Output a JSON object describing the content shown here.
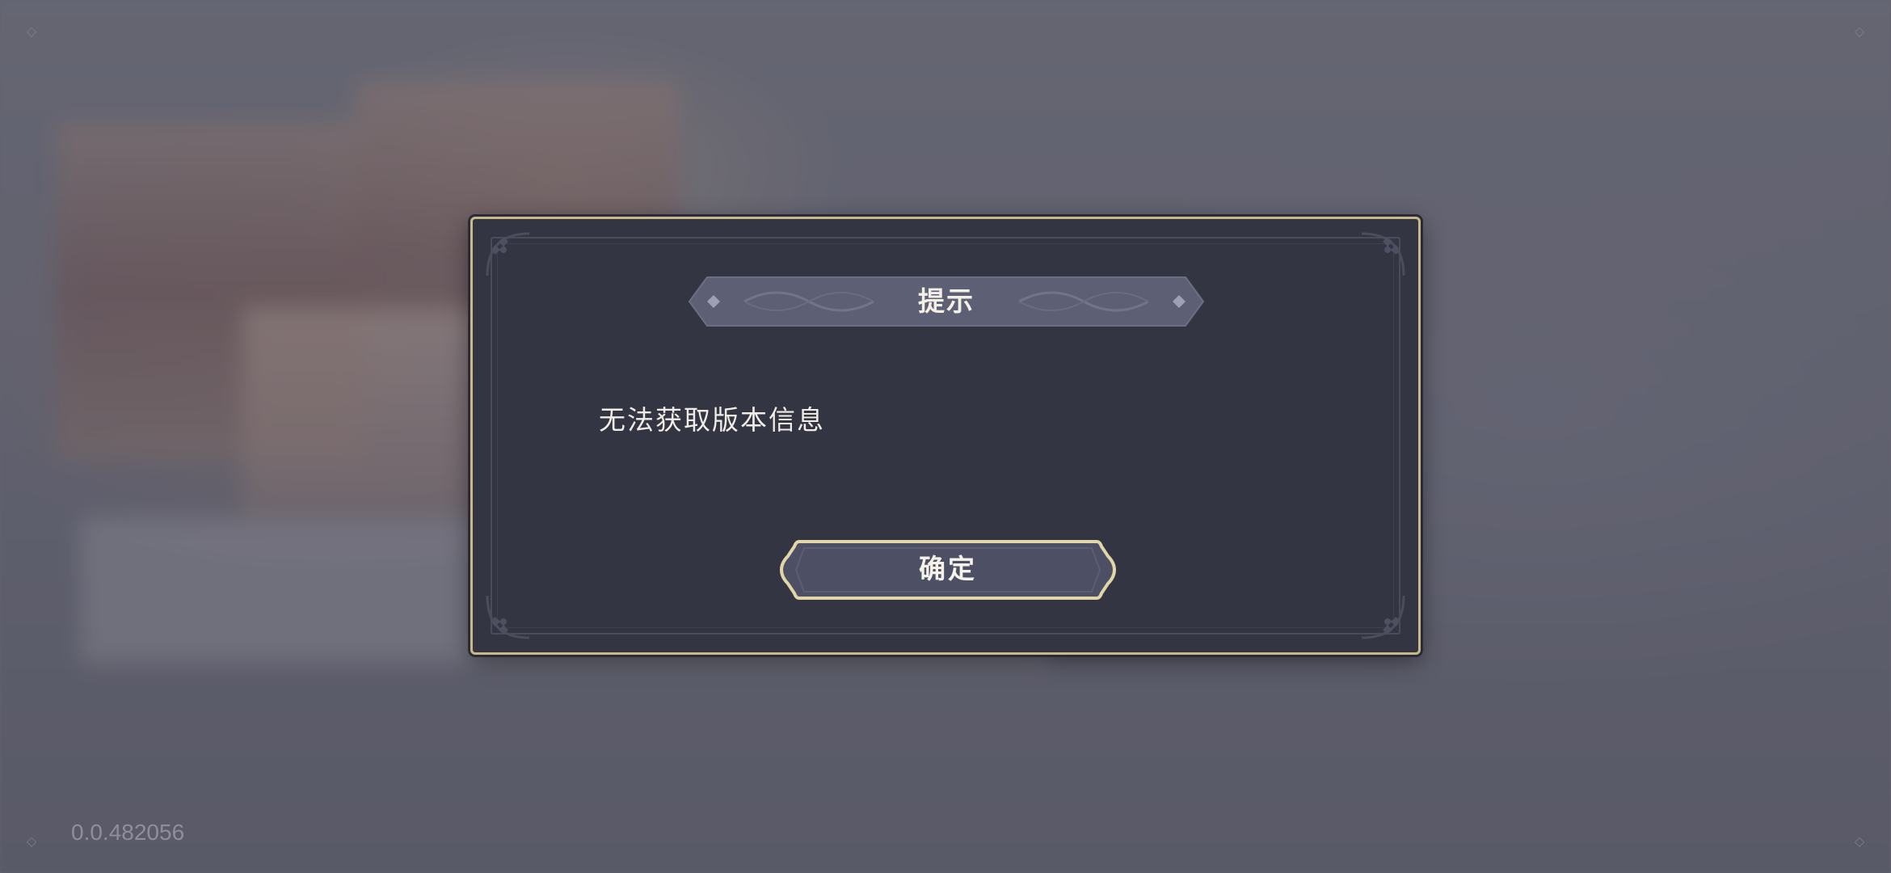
{
  "dialog": {
    "title": "提示",
    "message": "无法获取版本信息",
    "confirm_label": "确定"
  },
  "footer": {
    "version": "0.0.482056"
  },
  "colors": {
    "dialog_bg": "#333543",
    "dialog_border": "#c9b98a",
    "title_banner": "#5d6074",
    "button_bg": "#4d5064",
    "text": "#f0ede6",
    "version_text": "#8e8f9b"
  },
  "icons": {
    "corner_ornament": "fleur-de-lis-icon",
    "banner_diamond": "diamond-icon"
  }
}
